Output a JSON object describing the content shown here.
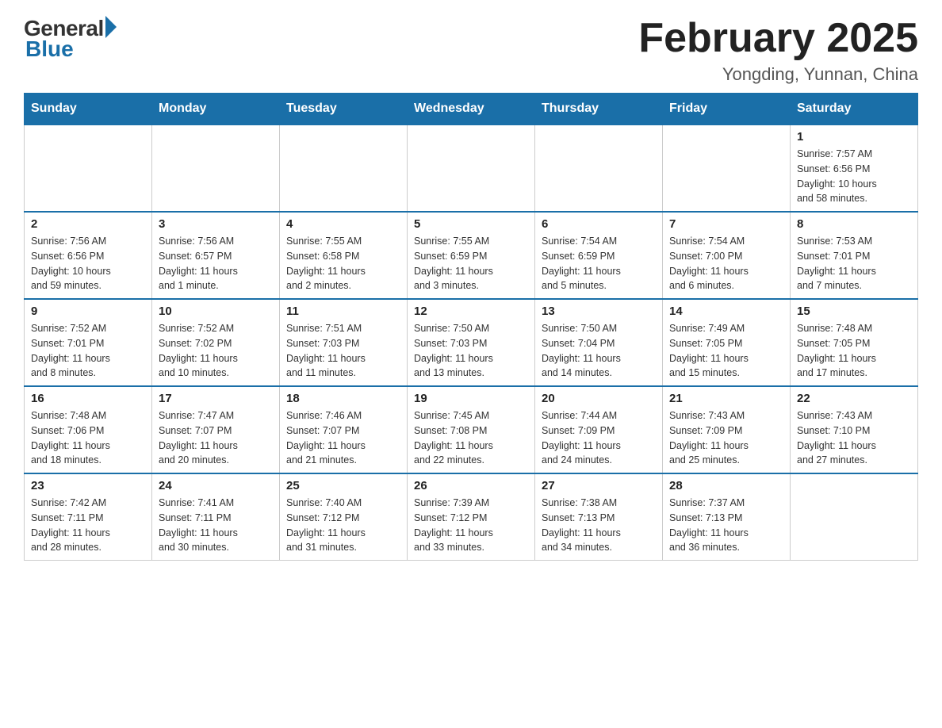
{
  "header": {
    "logo_general": "General",
    "logo_blue": "Blue",
    "title": "February 2025",
    "subtitle": "Yongding, Yunnan, China"
  },
  "weekdays": [
    "Sunday",
    "Monday",
    "Tuesday",
    "Wednesday",
    "Thursday",
    "Friday",
    "Saturday"
  ],
  "weeks": [
    [
      {
        "day": "",
        "info": []
      },
      {
        "day": "",
        "info": []
      },
      {
        "day": "",
        "info": []
      },
      {
        "day": "",
        "info": []
      },
      {
        "day": "",
        "info": []
      },
      {
        "day": "",
        "info": []
      },
      {
        "day": "1",
        "info": [
          "Sunrise: 7:57 AM",
          "Sunset: 6:56 PM",
          "Daylight: 10 hours",
          "and 58 minutes."
        ]
      }
    ],
    [
      {
        "day": "2",
        "info": [
          "Sunrise: 7:56 AM",
          "Sunset: 6:56 PM",
          "Daylight: 10 hours",
          "and 59 minutes."
        ]
      },
      {
        "day": "3",
        "info": [
          "Sunrise: 7:56 AM",
          "Sunset: 6:57 PM",
          "Daylight: 11 hours",
          "and 1 minute."
        ]
      },
      {
        "day": "4",
        "info": [
          "Sunrise: 7:55 AM",
          "Sunset: 6:58 PM",
          "Daylight: 11 hours",
          "and 2 minutes."
        ]
      },
      {
        "day": "5",
        "info": [
          "Sunrise: 7:55 AM",
          "Sunset: 6:59 PM",
          "Daylight: 11 hours",
          "and 3 minutes."
        ]
      },
      {
        "day": "6",
        "info": [
          "Sunrise: 7:54 AM",
          "Sunset: 6:59 PM",
          "Daylight: 11 hours",
          "and 5 minutes."
        ]
      },
      {
        "day": "7",
        "info": [
          "Sunrise: 7:54 AM",
          "Sunset: 7:00 PM",
          "Daylight: 11 hours",
          "and 6 minutes."
        ]
      },
      {
        "day": "8",
        "info": [
          "Sunrise: 7:53 AM",
          "Sunset: 7:01 PM",
          "Daylight: 11 hours",
          "and 7 minutes."
        ]
      }
    ],
    [
      {
        "day": "9",
        "info": [
          "Sunrise: 7:52 AM",
          "Sunset: 7:01 PM",
          "Daylight: 11 hours",
          "and 8 minutes."
        ]
      },
      {
        "day": "10",
        "info": [
          "Sunrise: 7:52 AM",
          "Sunset: 7:02 PM",
          "Daylight: 11 hours",
          "and 10 minutes."
        ]
      },
      {
        "day": "11",
        "info": [
          "Sunrise: 7:51 AM",
          "Sunset: 7:03 PM",
          "Daylight: 11 hours",
          "and 11 minutes."
        ]
      },
      {
        "day": "12",
        "info": [
          "Sunrise: 7:50 AM",
          "Sunset: 7:03 PM",
          "Daylight: 11 hours",
          "and 13 minutes."
        ]
      },
      {
        "day": "13",
        "info": [
          "Sunrise: 7:50 AM",
          "Sunset: 7:04 PM",
          "Daylight: 11 hours",
          "and 14 minutes."
        ]
      },
      {
        "day": "14",
        "info": [
          "Sunrise: 7:49 AM",
          "Sunset: 7:05 PM",
          "Daylight: 11 hours",
          "and 15 minutes."
        ]
      },
      {
        "day": "15",
        "info": [
          "Sunrise: 7:48 AM",
          "Sunset: 7:05 PM",
          "Daylight: 11 hours",
          "and 17 minutes."
        ]
      }
    ],
    [
      {
        "day": "16",
        "info": [
          "Sunrise: 7:48 AM",
          "Sunset: 7:06 PM",
          "Daylight: 11 hours",
          "and 18 minutes."
        ]
      },
      {
        "day": "17",
        "info": [
          "Sunrise: 7:47 AM",
          "Sunset: 7:07 PM",
          "Daylight: 11 hours",
          "and 20 minutes."
        ]
      },
      {
        "day": "18",
        "info": [
          "Sunrise: 7:46 AM",
          "Sunset: 7:07 PM",
          "Daylight: 11 hours",
          "and 21 minutes."
        ]
      },
      {
        "day": "19",
        "info": [
          "Sunrise: 7:45 AM",
          "Sunset: 7:08 PM",
          "Daylight: 11 hours",
          "and 22 minutes."
        ]
      },
      {
        "day": "20",
        "info": [
          "Sunrise: 7:44 AM",
          "Sunset: 7:09 PM",
          "Daylight: 11 hours",
          "and 24 minutes."
        ]
      },
      {
        "day": "21",
        "info": [
          "Sunrise: 7:43 AM",
          "Sunset: 7:09 PM",
          "Daylight: 11 hours",
          "and 25 minutes."
        ]
      },
      {
        "day": "22",
        "info": [
          "Sunrise: 7:43 AM",
          "Sunset: 7:10 PM",
          "Daylight: 11 hours",
          "and 27 minutes."
        ]
      }
    ],
    [
      {
        "day": "23",
        "info": [
          "Sunrise: 7:42 AM",
          "Sunset: 7:11 PM",
          "Daylight: 11 hours",
          "and 28 minutes."
        ]
      },
      {
        "day": "24",
        "info": [
          "Sunrise: 7:41 AM",
          "Sunset: 7:11 PM",
          "Daylight: 11 hours",
          "and 30 minutes."
        ]
      },
      {
        "day": "25",
        "info": [
          "Sunrise: 7:40 AM",
          "Sunset: 7:12 PM",
          "Daylight: 11 hours",
          "and 31 minutes."
        ]
      },
      {
        "day": "26",
        "info": [
          "Sunrise: 7:39 AM",
          "Sunset: 7:12 PM",
          "Daylight: 11 hours",
          "and 33 minutes."
        ]
      },
      {
        "day": "27",
        "info": [
          "Sunrise: 7:38 AM",
          "Sunset: 7:13 PM",
          "Daylight: 11 hours",
          "and 34 minutes."
        ]
      },
      {
        "day": "28",
        "info": [
          "Sunrise: 7:37 AM",
          "Sunset: 7:13 PM",
          "Daylight: 11 hours",
          "and 36 minutes."
        ]
      },
      {
        "day": "",
        "info": []
      }
    ]
  ]
}
